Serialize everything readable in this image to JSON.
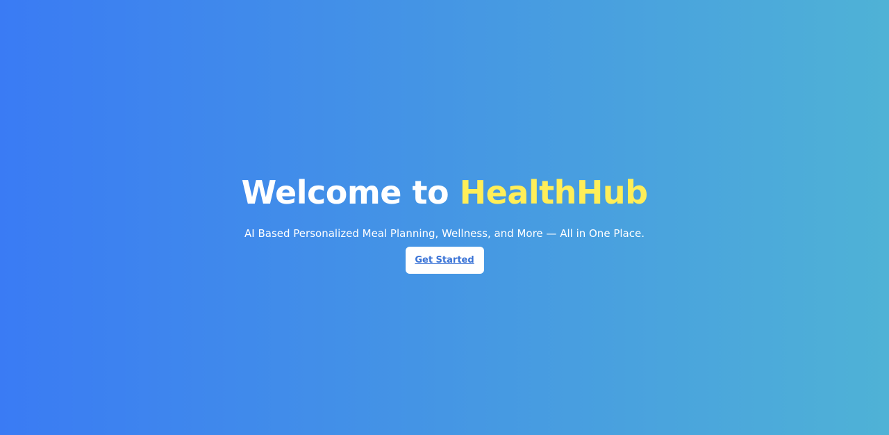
{
  "hero": {
    "title_prefix": "Welcome to ",
    "title_brand": "HealthHub",
    "subtitle": "AI Based Personalized Meal Planning, Wellness, and More — All in One Place.",
    "cta_label": "Get Started"
  },
  "colors": {
    "gradient_start": "#3a7bf4",
    "gradient_end": "#4fb2d6",
    "brand_highlight": "#ffee58",
    "cta_text": "#3a73d6"
  }
}
